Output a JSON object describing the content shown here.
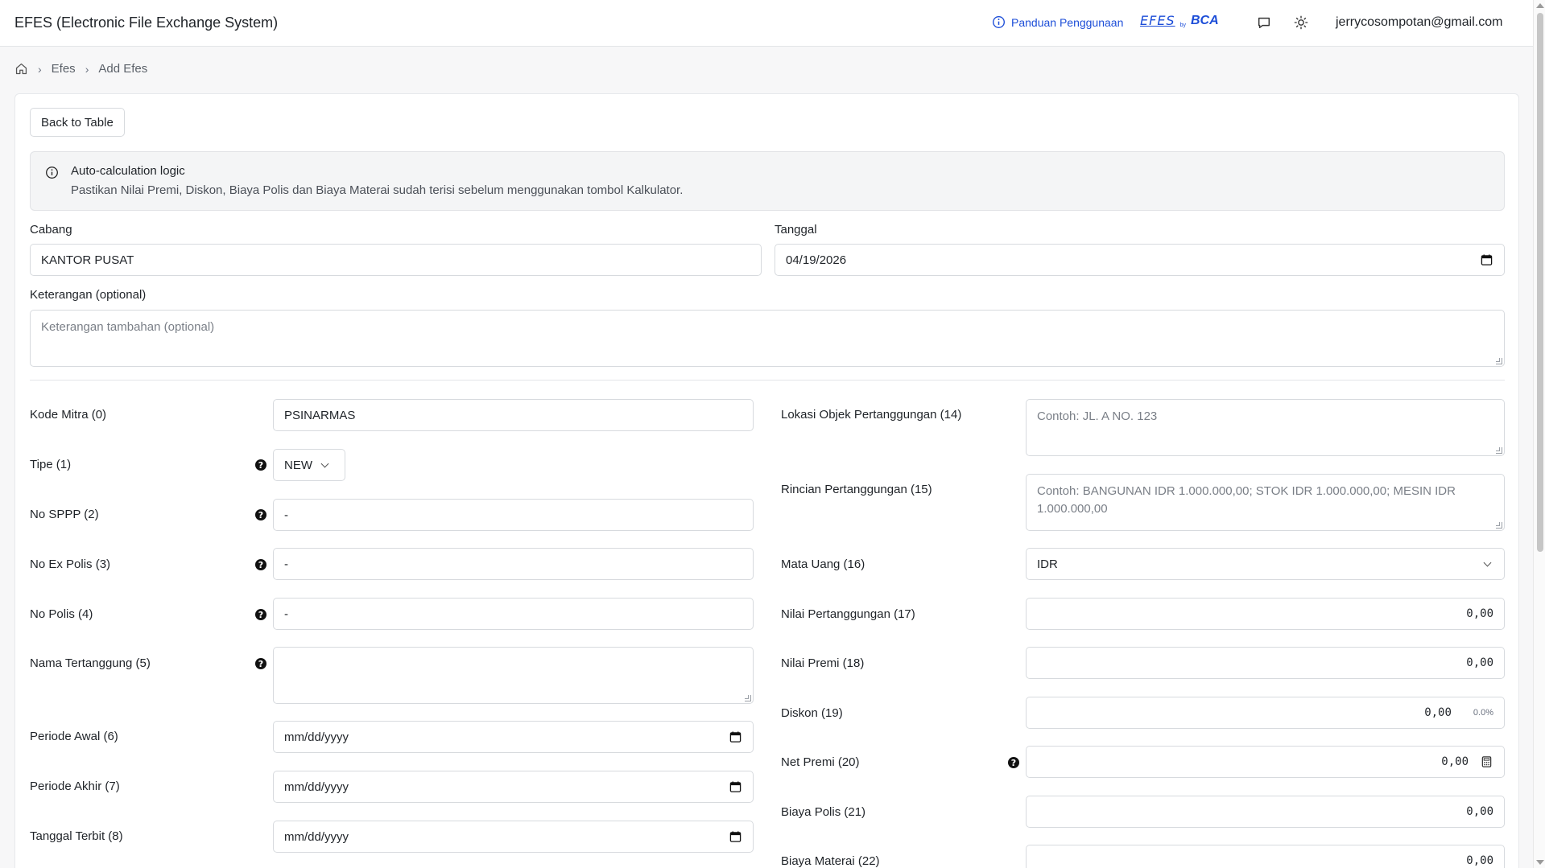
{
  "header": {
    "app_title": "EFES (Electronic File Exchange System)",
    "guide_label": "Panduan Penggunaan",
    "brand_efes": "EFES",
    "brand_by": "by",
    "brand_bca": "BCA",
    "user_email": "jerrycosompotan@gmail.com"
  },
  "breadcrumb": {
    "items": [
      "Efes",
      "Add Efes"
    ]
  },
  "back_button": "Back to Table",
  "alert": {
    "title": "Auto-calculation logic",
    "text": "Pastikan Nilai Premi, Diskon, Biaya Polis dan Biaya Materai sudah terisi sebelum menggunakan tombol Kalkulator."
  },
  "form": {
    "cabang": {
      "label": "Cabang",
      "value": "KANTOR PUSAT"
    },
    "tanggal": {
      "label": "Tanggal",
      "value": "04/19/2026"
    },
    "keterangan": {
      "label": "Keterangan (optional)",
      "placeholder": "Keterangan tambahan (optional)"
    },
    "left": {
      "kode_mitra": {
        "label": "Kode Mitra (0)",
        "value": "PSINARMAS"
      },
      "tipe": {
        "label": "Tipe (1)",
        "value": "NEW"
      },
      "no_sppp": {
        "label": "No SPPP (2)",
        "value": "-"
      },
      "no_ex_polis": {
        "label": "No Ex Polis (3)",
        "value": "-"
      },
      "no_polis": {
        "label": "No Polis (4)",
        "value": "-"
      },
      "nama_tertanggung": {
        "label": "Nama Tertanggung (5)",
        "value": ""
      },
      "periode_awal": {
        "label": "Periode Awal (6)",
        "placeholder": "mm/dd/yyyy"
      },
      "periode_akhir": {
        "label": "Periode Akhir (7)",
        "placeholder": "mm/dd/yyyy"
      },
      "tanggal_terbit": {
        "label": "Tanggal Terbit (8)",
        "placeholder": "mm/dd/yyyy"
      }
    },
    "right": {
      "lokasi_objek": {
        "label": "Lokasi Objek Pertanggungan (14)",
        "placeholder": "Contoh: JL. A NO. 123"
      },
      "rincian": {
        "label": "Rincian Pertanggungan (15)",
        "placeholder": "Contoh: BANGUNAN IDR 1.000.000,00; STOK IDR 1.000.000,00; MESIN IDR 1.000.000,00"
      },
      "mata_uang": {
        "label": "Mata Uang (16)",
        "value": "IDR"
      },
      "nilai_pertanggungan": {
        "label": "Nilai Pertanggungan (17)",
        "value": "0,00"
      },
      "nilai_premi": {
        "label": "Nilai Premi (18)",
        "value": "0,00"
      },
      "diskon": {
        "label": "Diskon (19)",
        "value": "0,00",
        "percent": "0.0%"
      },
      "net_premi": {
        "label": "Net Premi (20)",
        "value": "0,00"
      },
      "biaya_polis": {
        "label": "Biaya Polis (21)",
        "value": "0,00"
      },
      "biaya_materai": {
        "label": "Biaya Materai (22)",
        "value": "0,00"
      }
    }
  },
  "colors": {
    "accent": "#1d4ed8",
    "border": "#d7dade",
    "alert_bg": "#f4f5f6"
  }
}
